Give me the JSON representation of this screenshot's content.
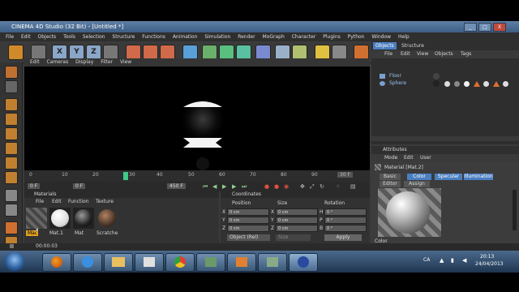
{
  "window": {
    "title": "CINEMA 4D Studio (32 Bit) - [Untitled *]",
    "min": "_",
    "max": "□",
    "close": "X"
  },
  "menubar": [
    "File",
    "Edit",
    "Objects",
    "Tools",
    "Selection",
    "Structure",
    "Functions",
    "Animation",
    "Simulation",
    "Render",
    "MoGraph",
    "Character",
    "Plugins",
    "Python",
    "Window",
    "Help"
  ],
  "toolbar": {
    "x": "X",
    "y": "Y",
    "z": "Z"
  },
  "viewport": {
    "menu": [
      "Edit",
      "Cameras",
      "Display",
      "Filter",
      "View"
    ]
  },
  "timeline": {
    "ticks": [
      "0",
      "10",
      "20",
      "30",
      "40",
      "50",
      "60",
      "70",
      "80",
      "90"
    ],
    "end_frame": "30 F",
    "current": "0 F",
    "range_start": "0 F",
    "range_end": "450 F"
  },
  "materials": {
    "title": "Materials",
    "menu": [
      "File",
      "Edit",
      "Function",
      "Texture"
    ],
    "items": [
      "Mat",
      "Mat.1",
      "Mat",
      "Scratche"
    ],
    "tooltip": "Mat"
  },
  "coordinates": {
    "title": "Coordinates",
    "headers": [
      "Position",
      "Size",
      "Rotation"
    ],
    "rows": [
      {
        "axis": "X",
        "pos": "0 cm",
        "s_axis": "X",
        "size": "0 cm",
        "r_axis": "H",
        "rot": "0 °"
      },
      {
        "axis": "Y",
        "pos": "0 cm",
        "s_axis": "Y",
        "size": "0 cm",
        "r_axis": "P",
        "rot": "0 °"
      },
      {
        "axis": "Z",
        "pos": "0 cm",
        "s_axis": "Z",
        "size": "0 cm",
        "r_axis": "B",
        "rot": "0 °"
      }
    ],
    "mode": "Object (Rel)",
    "size_mode": "Size",
    "apply": "Apply"
  },
  "objects": {
    "tabs": [
      "Objects",
      "Structure"
    ],
    "menu": [
      "File",
      "Edit",
      "View",
      "Objects",
      "Tags"
    ],
    "items": [
      {
        "name": "Floor"
      },
      {
        "name": "Sphere"
      }
    ]
  },
  "attributes": {
    "title": "Attributes",
    "menu": [
      "Mode",
      "Edit",
      "User"
    ],
    "material_name": "Material [Mat.2]",
    "tabs": [
      "Basic",
      "Color",
      "Specular",
      "Illumination",
      "Editor",
      "Assign"
    ],
    "active_tab": "Color",
    "section": "Color"
  },
  "status": {
    "time": "00:00:03"
  },
  "taskbar": {
    "lang": "CA",
    "clock_time": "20:13",
    "clock_date": "24/04/2013"
  },
  "colors": {
    "active_tab": "#4a7fc1",
    "timeline_marker": "#3fc98a"
  }
}
